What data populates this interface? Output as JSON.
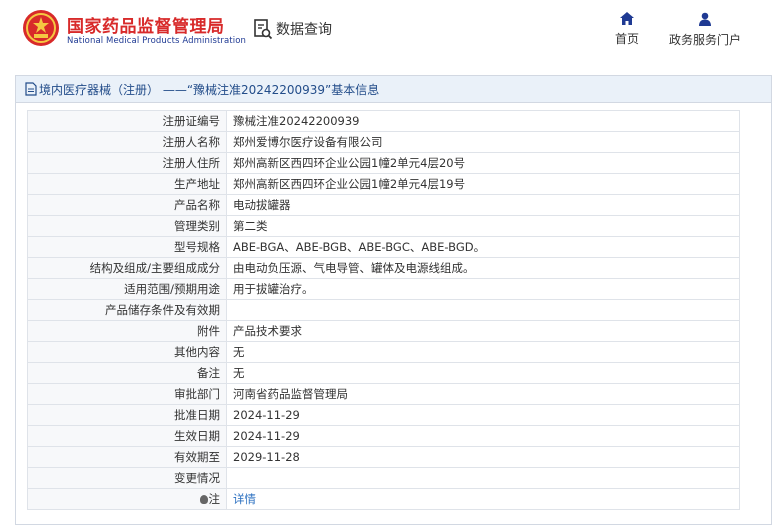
{
  "header": {
    "brand_cn": "国家药品监督管理局",
    "brand_en": "National Medical Products Administration",
    "query_label": "数据查询",
    "nav": [
      {
        "label": "首页",
        "icon": "home-icon"
      },
      {
        "label": "政务服务门户",
        "icon": "user-icon"
      }
    ]
  },
  "title": "境内医疗器械（注册） ——“豫械注准20242200939”基本信息",
  "rows": [
    {
      "label": "注册证编号",
      "value": "豫械注准20242200939"
    },
    {
      "label": "注册人名称",
      "value": "郑州爱博尔医疗设备有限公司"
    },
    {
      "label": "注册人住所",
      "value": "郑州高新区西四环企业公园1幢2单元4层20号"
    },
    {
      "label": "生产地址",
      "value": "郑州高新区西四环企业公园1幢2单元4层19号"
    },
    {
      "label": "产品名称",
      "value": "电动拔罐器"
    },
    {
      "label": "管理类别",
      "value": "第二类"
    },
    {
      "label": "型号规格",
      "value": "ABE-BGA、ABE-BGB、ABE-BGC、ABE-BGD。"
    },
    {
      "label": "结构及组成/主要组成成分",
      "value": "由电动负压源、气电导管、罐体及电源线组成。"
    },
    {
      "label": "适用范围/预期用途",
      "value": "用于拔罐治疗。"
    },
    {
      "label": "产品储存条件及有效期",
      "value": ""
    },
    {
      "label": "附件",
      "value": "产品技术要求"
    },
    {
      "label": "其他内容",
      "value": "无"
    },
    {
      "label": "备注",
      "value": "无"
    },
    {
      "label": "审批部门",
      "value": "河南省药品监督管理局"
    },
    {
      "label": "批准日期",
      "value": "2024-11-29"
    },
    {
      "label": "生效日期",
      "value": "2024-11-29"
    },
    {
      "label": "有效期至",
      "value": "2029-11-28"
    },
    {
      "label": "变更情况",
      "value": ""
    }
  ],
  "note": {
    "label": "注",
    "link": "详情",
    "icon": "lightbulb-icon"
  },
  "colors": {
    "brand_red": "#d82a2a",
    "brand_blue": "#1f3a93",
    "link": "#2a6fc0",
    "title_bg": "#eaf1f9"
  }
}
